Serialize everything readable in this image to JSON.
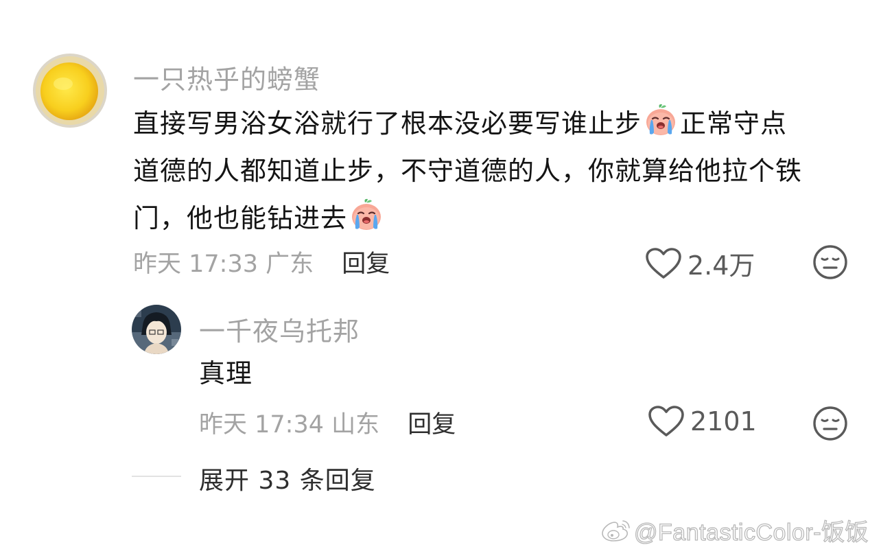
{
  "comment": {
    "username": "一只热乎的螃蟹",
    "text_line_1a": "直接写男浴女浴就行了根本没必要写谁止步",
    "text_line_1b": "正常守点",
    "text_line_2": "道德的人都知道止步，不守道德的人，你就算给他拉个铁",
    "text_line_3": "门，他也能钻进去",
    "emojis": [
      "crying-peach-emoji",
      "crying-peach-emoji"
    ],
    "time": "昨天 17:33",
    "location": "广东",
    "reply_label": "回复",
    "like_count": "2.4万",
    "reply": {
      "username": "一千夜乌托邦",
      "text": "真理",
      "time": "昨天 17:34",
      "location": "山东",
      "reply_label": "回复",
      "like_count": "2101"
    },
    "expand_label": "展开 33 条回复"
  },
  "icons": {
    "like": "heart-outline-icon",
    "react": "neutral-face-icon",
    "watermark": "weibo-logo-icon"
  },
  "watermark": {
    "text": "@FantasticColor-饭饭"
  },
  "colors": {
    "username": "#a3a3a3",
    "body_text": "#141414",
    "meta": "#a3a3a3",
    "action": "#2e2e2e",
    "icon": "#5a5a5a"
  }
}
